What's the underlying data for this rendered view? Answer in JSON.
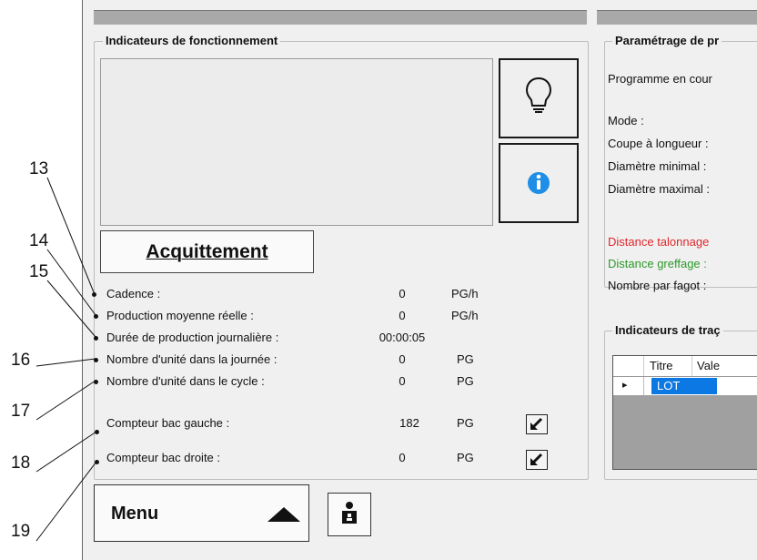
{
  "left_panel": {
    "title": "Indicateurs de fonctionnement",
    "ack_label": "Acquittement",
    "rows": [
      {
        "label": "Cadence :",
        "value": "0",
        "unit": "PG/h"
      },
      {
        "label": "Production moyenne réelle :",
        "value": "0",
        "unit": "PG/h"
      },
      {
        "label": "Durée de production journalière :",
        "value": "00:00:05",
        "unit": ""
      },
      {
        "label": "Nombre d'unité dans la journée :",
        "value": "0",
        "unit": "PG"
      },
      {
        "label": "Nombre d'unité dans le cycle :",
        "value": "0",
        "unit": "PG"
      },
      {
        "label": "Compteur bac gauche :",
        "value": "182",
        "unit": "PG"
      },
      {
        "label": "Compteur bac droite :",
        "value": "0",
        "unit": "PG"
      }
    ],
    "icons": {
      "bulb": "lightbulb-icon",
      "info": "info-icon",
      "reset": "reset-arrow-icon"
    }
  },
  "menu": {
    "label": "Menu",
    "user_icon": "user-icon"
  },
  "right_panel": {
    "title": "Paramétrage de pr",
    "program_label": "Programme en cour",
    "mode_label": "Mode :",
    "cut_label": "Coupe à longueur :",
    "dmin_label": "Diamètre minimal :",
    "dmax_label": "Diamètre maximal :",
    "talon_label": "Distance talonnage",
    "greffage_label": "Distance greffage :",
    "fagot_label": "Nombre par fagot :",
    "talon_color": "#e0262b",
    "greffage_color": "#2a9a2a"
  },
  "trace_panel": {
    "title": "Indicateurs de traç",
    "col_titre": "Titre",
    "col_valeur": "Vale",
    "row_marker": "▸",
    "row_value": "LOT"
  },
  "callouts": [
    "13",
    "14",
    "15",
    "16",
    "17",
    "18",
    "19"
  ]
}
